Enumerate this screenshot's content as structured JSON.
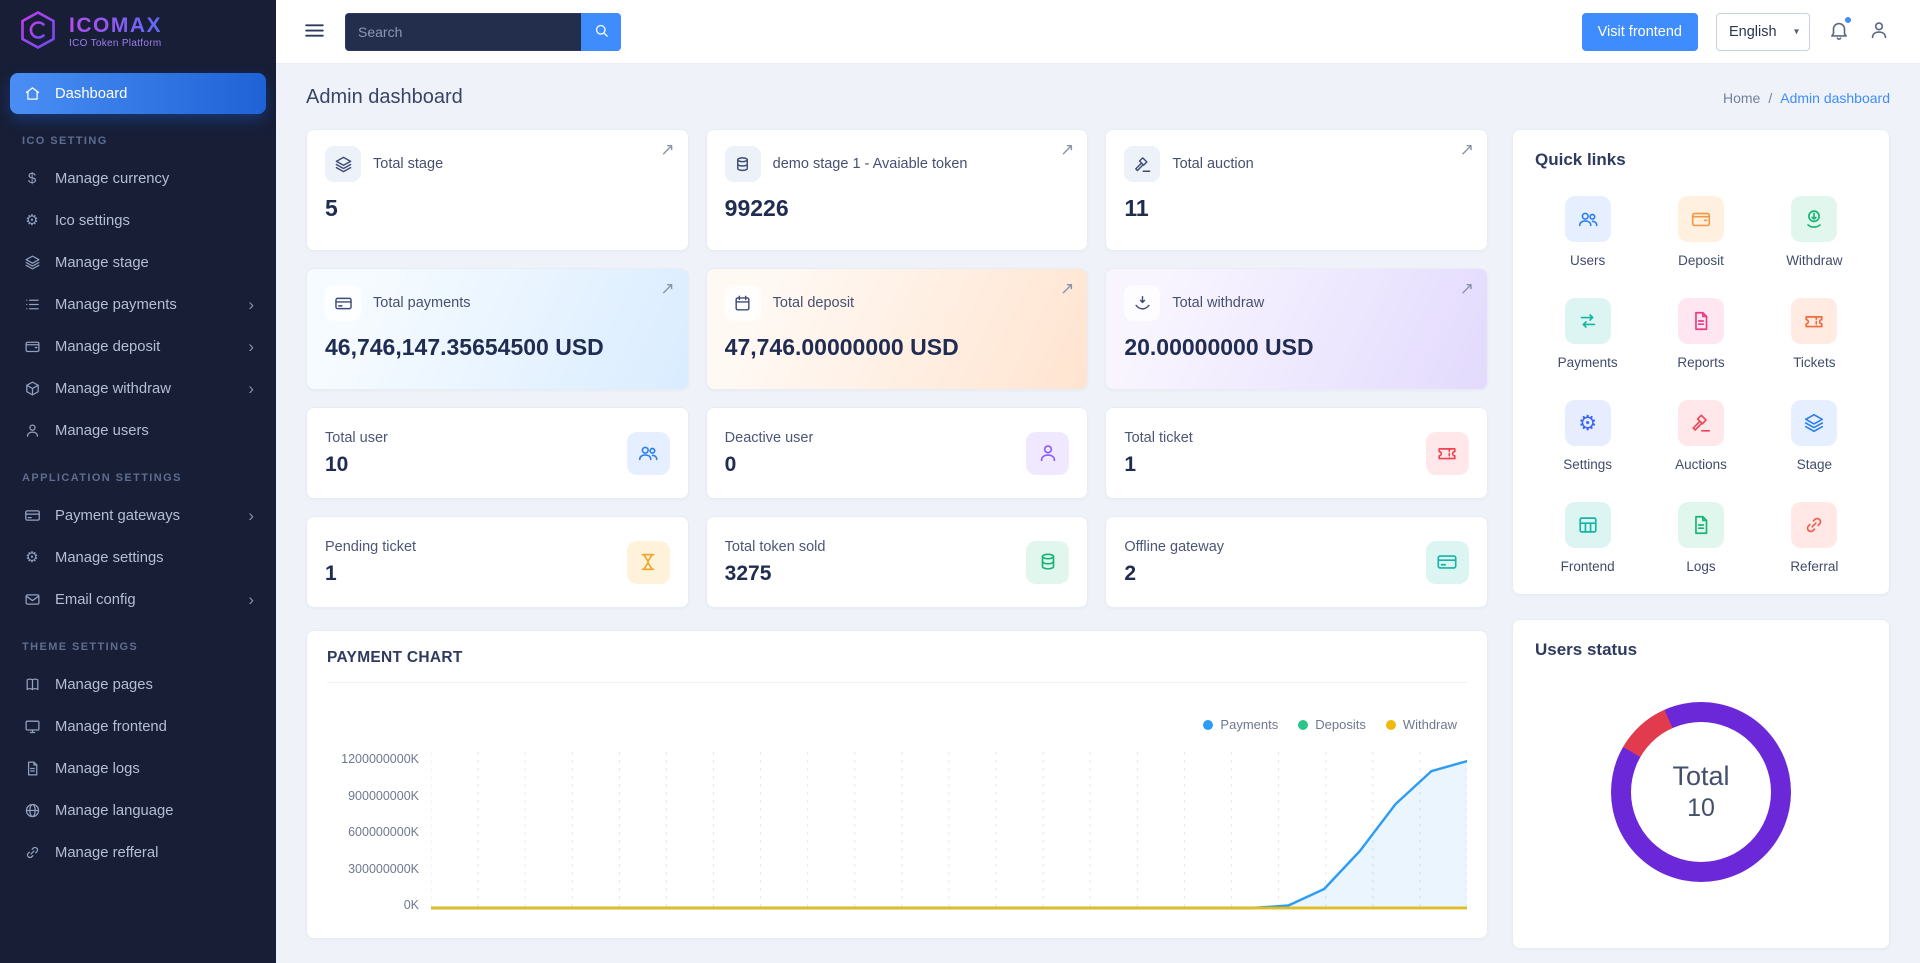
{
  "topbar": {
    "search_placeholder": "Search",
    "visit_frontend_label": "Visit frontend",
    "language": "English"
  },
  "page": {
    "title": "Admin dashboard",
    "breadcrumb": {
      "home": "Home",
      "separator": "/",
      "current": "Admin dashboard"
    }
  },
  "sidebar": {
    "logo": {
      "title": "ICOMAX",
      "subtitle": "ICO Token Platform"
    },
    "sections": [
      {
        "header": null,
        "items": [
          {
            "label": "Dashboard",
            "icon": "house",
            "active": true
          }
        ]
      },
      {
        "header": "ICO SETTING",
        "items": [
          {
            "label": "Manage currency",
            "icon": "dollar"
          },
          {
            "label": "Ico settings",
            "icon": "gear"
          },
          {
            "label": "Manage stage",
            "icon": "layers"
          },
          {
            "label": "Manage payments",
            "icon": "list",
            "chevron": true
          },
          {
            "label": "Manage deposit",
            "icon": "wallet",
            "chevron": true
          },
          {
            "label": "Manage withdraw",
            "icon": "cube",
            "chevron": true
          },
          {
            "label": "Manage users",
            "icon": "user"
          }
        ]
      },
      {
        "header": "APPLICATION SETTINGS",
        "items": [
          {
            "label": "Payment gateways",
            "icon": "card",
            "chevron": true
          },
          {
            "label": "Manage settings",
            "icon": "gear"
          },
          {
            "label": "Email config",
            "icon": "mail",
            "chevron": true
          }
        ]
      },
      {
        "header": "THEME SETTINGS",
        "items": [
          {
            "label": "Manage pages",
            "icon": "pages"
          },
          {
            "label": "Manage frontend",
            "icon": "monitor"
          },
          {
            "label": "Manage logs",
            "icon": "file"
          },
          {
            "label": "Manage language",
            "icon": "globe"
          },
          {
            "label": "Manage refferal",
            "icon": "link"
          }
        ]
      }
    ]
  },
  "stats": [
    {
      "label": "Total stage",
      "value": "5",
      "icon": "layers",
      "kind": "overview",
      "variant": "plain"
    },
    {
      "label": "demo stage 1 - Avaiable token",
      "value": "99226",
      "icon": "coins",
      "kind": "overview",
      "variant": "plain"
    },
    {
      "label": "Total auction",
      "value": "11",
      "icon": "auction",
      "kind": "overview",
      "variant": "plain"
    },
    {
      "label": "Total payments",
      "value": "46,746,147.35654500 USD",
      "icon": "card",
      "kind": "overview",
      "variant": "gradient-blue"
    },
    {
      "label": "Total deposit",
      "value": "47,746.00000000 USD",
      "icon": "calendar",
      "kind": "overview",
      "variant": "gradient-orange"
    },
    {
      "label": "Total withdraw",
      "value": "20.00000000 USD",
      "icon": "withdraw",
      "kind": "overview",
      "variant": "gradient-purple"
    },
    {
      "label": "Total user",
      "value": "10",
      "icon": "users",
      "kind": "compact",
      "accent": "blue"
    },
    {
      "label": "Deactive user",
      "value": "0",
      "icon": "user",
      "kind": "compact",
      "accent": "purple"
    },
    {
      "label": "Total ticket",
      "value": "1",
      "icon": "ticket",
      "kind": "compact",
      "accent": "red"
    },
    {
      "label": "Pending ticket",
      "value": "1",
      "icon": "hourglass",
      "kind": "compact",
      "accent": "amber"
    },
    {
      "label": "Total token sold",
      "value": "3275",
      "icon": "coins",
      "kind": "compact",
      "accent": "green"
    },
    {
      "label": "Offline gateway",
      "value": "2",
      "icon": "card",
      "kind": "compact",
      "accent": "teal"
    }
  ],
  "payment_chart": {
    "title": "PAYMENT CHART",
    "chart_data": {
      "type": "line",
      "title": "PAYMENT CHART",
      "legend_position": "top-right",
      "grid": "vertical-dashed",
      "ylim": [
        0,
        1200000000
      ],
      "y_tick_labels": [
        "1200000000K",
        "900000000K",
        "600000000K",
        "300000000K",
        "0K"
      ],
      "series": [
        {
          "name": "Payments",
          "color": "#2d9cf4",
          "fill": true,
          "values": [
            0,
            0,
            0,
            0,
            0,
            0,
            0,
            0,
            0,
            0,
            0,
            0,
            0,
            0,
            0,
            0,
            0,
            0,
            0,
            0,
            0,
            0,
            0,
            0,
            20000000,
            150000000,
            450000000,
            820000000,
            1080000000,
            1160000000
          ]
        },
        {
          "name": "Deposits",
          "color": "#2bc48a",
          "values": [
            0,
            0,
            0,
            0,
            0,
            0,
            0,
            0,
            0,
            0,
            0,
            0,
            0,
            0,
            0,
            0,
            0,
            0,
            0,
            0,
            0,
            0,
            0,
            0,
            0,
            0,
            0,
            0,
            0,
            0
          ]
        },
        {
          "name": "Withdraw",
          "color": "#f1b90e",
          "values": [
            0,
            0,
            0,
            0,
            0,
            0,
            0,
            0,
            0,
            0,
            0,
            0,
            0,
            0,
            0,
            0,
            0,
            0,
            0,
            0,
            0,
            0,
            0,
            0,
            0,
            0,
            0,
            0,
            0,
            0
          ]
        }
      ]
    }
  },
  "quick_links": {
    "title": "Quick links",
    "items": [
      {
        "label": "Users",
        "icon": "users",
        "accent": "blue"
      },
      {
        "label": "Deposit",
        "icon": "wallet",
        "accent": "orange"
      },
      {
        "label": "Withdraw",
        "icon": "money-down",
        "accent": "green"
      },
      {
        "label": "Payments",
        "icon": "exchange",
        "accent": "teal"
      },
      {
        "label": "Reports",
        "icon": "file",
        "accent": "pink"
      },
      {
        "label": "Tickets",
        "icon": "ticket",
        "accent": "orangered"
      },
      {
        "label": "Settings",
        "icon": "gear",
        "accent": "indigo"
      },
      {
        "label": "Auctions",
        "icon": "auction",
        "accent": "red"
      },
      {
        "label": "Stage",
        "icon": "layers",
        "accent": "blue"
      },
      {
        "label": "Frontend",
        "icon": "table",
        "accent": "teal"
      },
      {
        "label": "Logs",
        "icon": "file",
        "accent": "green"
      },
      {
        "label": "Referral",
        "icon": "link",
        "accent": "rose"
      }
    ]
  },
  "users_status": {
    "title": "Users status",
    "center_label": "Total",
    "center_value": "10",
    "chart_data": {
      "type": "donut",
      "start_angle": -60,
      "segments": [
        {
          "value": 1,
          "color": "#e23b4e"
        },
        {
          "value": 9,
          "color": "#6a28d9"
        }
      ]
    }
  }
}
